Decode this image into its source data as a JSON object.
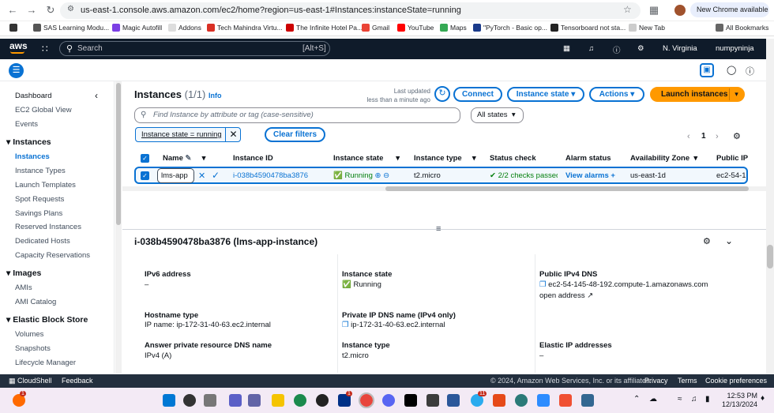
{
  "browser": {
    "url": "us-east-1.console.aws.amazon.com/ec2/home?region=us-east-1#Instances:instanceState=running",
    "new_chrome": "New Chrome available",
    "bookmarks": [
      "SAS Learning Modu...",
      "Magic Autofill",
      "Addons",
      "Tech Mahindra Virtu...",
      "The Infinite Hotel Pa...",
      "Gmail",
      "YouTube",
      "Maps",
      "\"PyTorch - Basic op...",
      "Tensorboard not sta...",
      "New Tab"
    ],
    "all_bookmarks": "All Bookmarks"
  },
  "aws_header": {
    "logo": "aws",
    "search_placeholder": "Search",
    "search_shortcut": "[Alt+S]",
    "region": "N. Virginia",
    "user": "numpyninja"
  },
  "sidebar": {
    "dashboard": "Dashboard",
    "global_view": "EC2 Global View",
    "events": "Events",
    "sections": [
      {
        "title": "Instances",
        "items": [
          "Instances",
          "Instance Types",
          "Launch Templates",
          "Spot Requests",
          "Savings Plans",
          "Reserved Instances",
          "Dedicated Hosts",
          "Capacity Reservations"
        ]
      },
      {
        "title": "Images",
        "items": [
          "AMIs",
          "AMI Catalog"
        ]
      },
      {
        "title": "Elastic Block Store",
        "items": [
          "Volumes",
          "Snapshots",
          "Lifecycle Manager"
        ]
      }
    ]
  },
  "instances": {
    "title": "Instances",
    "count": "(1/1)",
    "info": "Info",
    "last_updated_label": "Last updated",
    "last_updated_value": "less than a minute ago",
    "connect": "Connect",
    "instance_state": "Instance state",
    "actions": "Actions",
    "launch": "Launch instances",
    "filter_placeholder": "Find Instance by attribute or tag (case-sensitive)",
    "all_states": "All states",
    "filter_token": "Instance state = running",
    "clear_filters": "Clear filters",
    "page": "1",
    "columns": [
      "Name",
      "Instance ID",
      "Instance state",
      "Instance type",
      "Status check",
      "Alarm status",
      "Availability Zone",
      "Public IP"
    ],
    "row": {
      "name": "lms-app",
      "id": "i-038b4590478ba3876",
      "state": "Running",
      "type": "t2.micro",
      "status": "2/2 checks passed",
      "alarm": "View alarms",
      "az": "us-east-1d",
      "public": "ec2-54-1"
    }
  },
  "details": {
    "title": "i-038b4590478ba3876 (lms-app-instance)",
    "fields": [
      {
        "label": "IPv6 address",
        "value": "–"
      },
      {
        "label": "Instance state",
        "value": "Running"
      },
      {
        "label": "Public IPv4 DNS",
        "value": "ec2-54-145-48-192.compute-1.amazonaws.com",
        "link": "open address"
      },
      {
        "label": "Hostname type",
        "value": "IP name: ip-172-31-40-63.ec2.internal"
      },
      {
        "label": "Private IP DNS name (IPv4 only)",
        "value": "ip-172-31-40-63.ec2.internal"
      },
      {
        "label": "Answer private resource DNS name",
        "value": "IPv4 (A)"
      },
      {
        "label": "Instance type",
        "value": "t2.micro"
      },
      {
        "label": "Elastic IP addresses",
        "value": "–"
      }
    ]
  },
  "footer": {
    "cloudshell": "CloudShell",
    "feedback": "Feedback",
    "copyright": "© 2024, Amazon Web Services, Inc. or its affiliates.",
    "privacy": "Privacy",
    "terms": "Terms",
    "cookies": "Cookie preferences"
  },
  "taskbar": {
    "time": "12:53 PM",
    "date": "12/13/2024",
    "badge1": "1",
    "badge2": "1",
    "badge3": "11"
  },
  "colors": {
    "accent": "#0972d3",
    "brand": "#ff9900",
    "nav": "#0f1b2a",
    "running": "#037f0c"
  }
}
